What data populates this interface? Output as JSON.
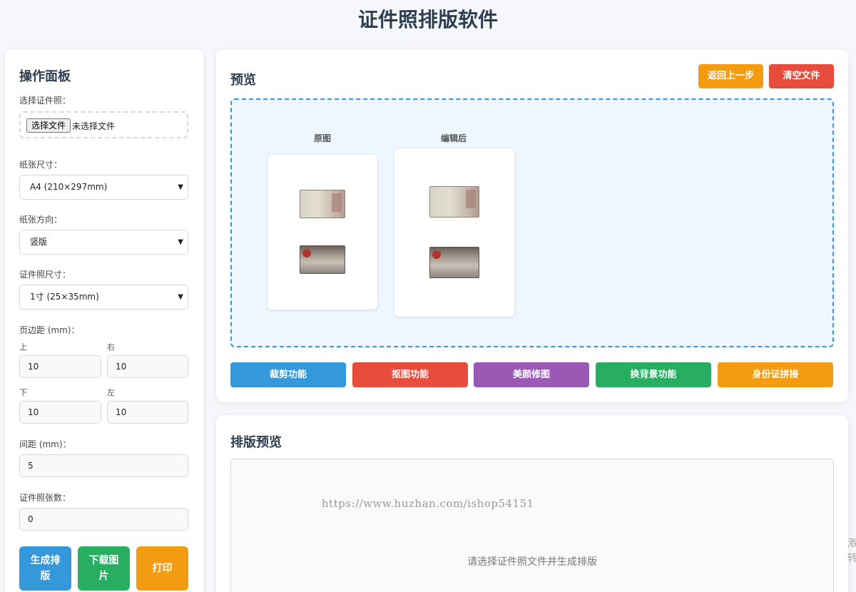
{
  "app": {
    "title": "证件照排版软件"
  },
  "control_panel": {
    "title": "操作面板",
    "file": {
      "label": "选择证件照：",
      "button": "选择文件",
      "status": "未选择文件"
    },
    "paper_size": {
      "label": "纸张尺寸：",
      "selected": "A4 (210×297mm)"
    },
    "orientation": {
      "label": "纸张方向：",
      "selected": "竖版"
    },
    "photo_size": {
      "label": "证件照尺寸：",
      "selected": "1寸 (25×35mm)"
    },
    "margins": {
      "label": "页边距 (mm)：",
      "top_label": "上",
      "top": "10",
      "right_label": "右",
      "right": "10",
      "bottom_label": "下",
      "bottom": "10",
      "left_label": "左",
      "left": "10"
    },
    "spacing": {
      "label": "间距 (mm)：",
      "value": "5"
    },
    "count": {
      "label": "证件照张数：",
      "value": "0"
    },
    "actions": {
      "generate": "生成排版",
      "download": "下载图片",
      "print": "打印"
    }
  },
  "preview": {
    "title": "预览",
    "back_button": "返回上一步",
    "clear_button": "清空文件",
    "original_caption": "原图",
    "edited_caption": "编辑后",
    "functions": [
      "裁剪功能",
      "抠图功能",
      "美颜修图",
      "换背景功能",
      "身份证拼接"
    ]
  },
  "layout_preview": {
    "title": "排版预览",
    "empty_message": "请选择证件照文件并生成排版"
  },
  "watermark": "https://www.huzhan.com/ishop54151",
  "edge_text": [
    "激",
    "转"
  ],
  "colors": {
    "blue": "#3498db",
    "red": "#e74c3c",
    "purple": "#9b59b6",
    "green": "#27ae60",
    "orange": "#f39c12"
  },
  "icons": {
    "select_chevron": "chevron-down-icon"
  }
}
